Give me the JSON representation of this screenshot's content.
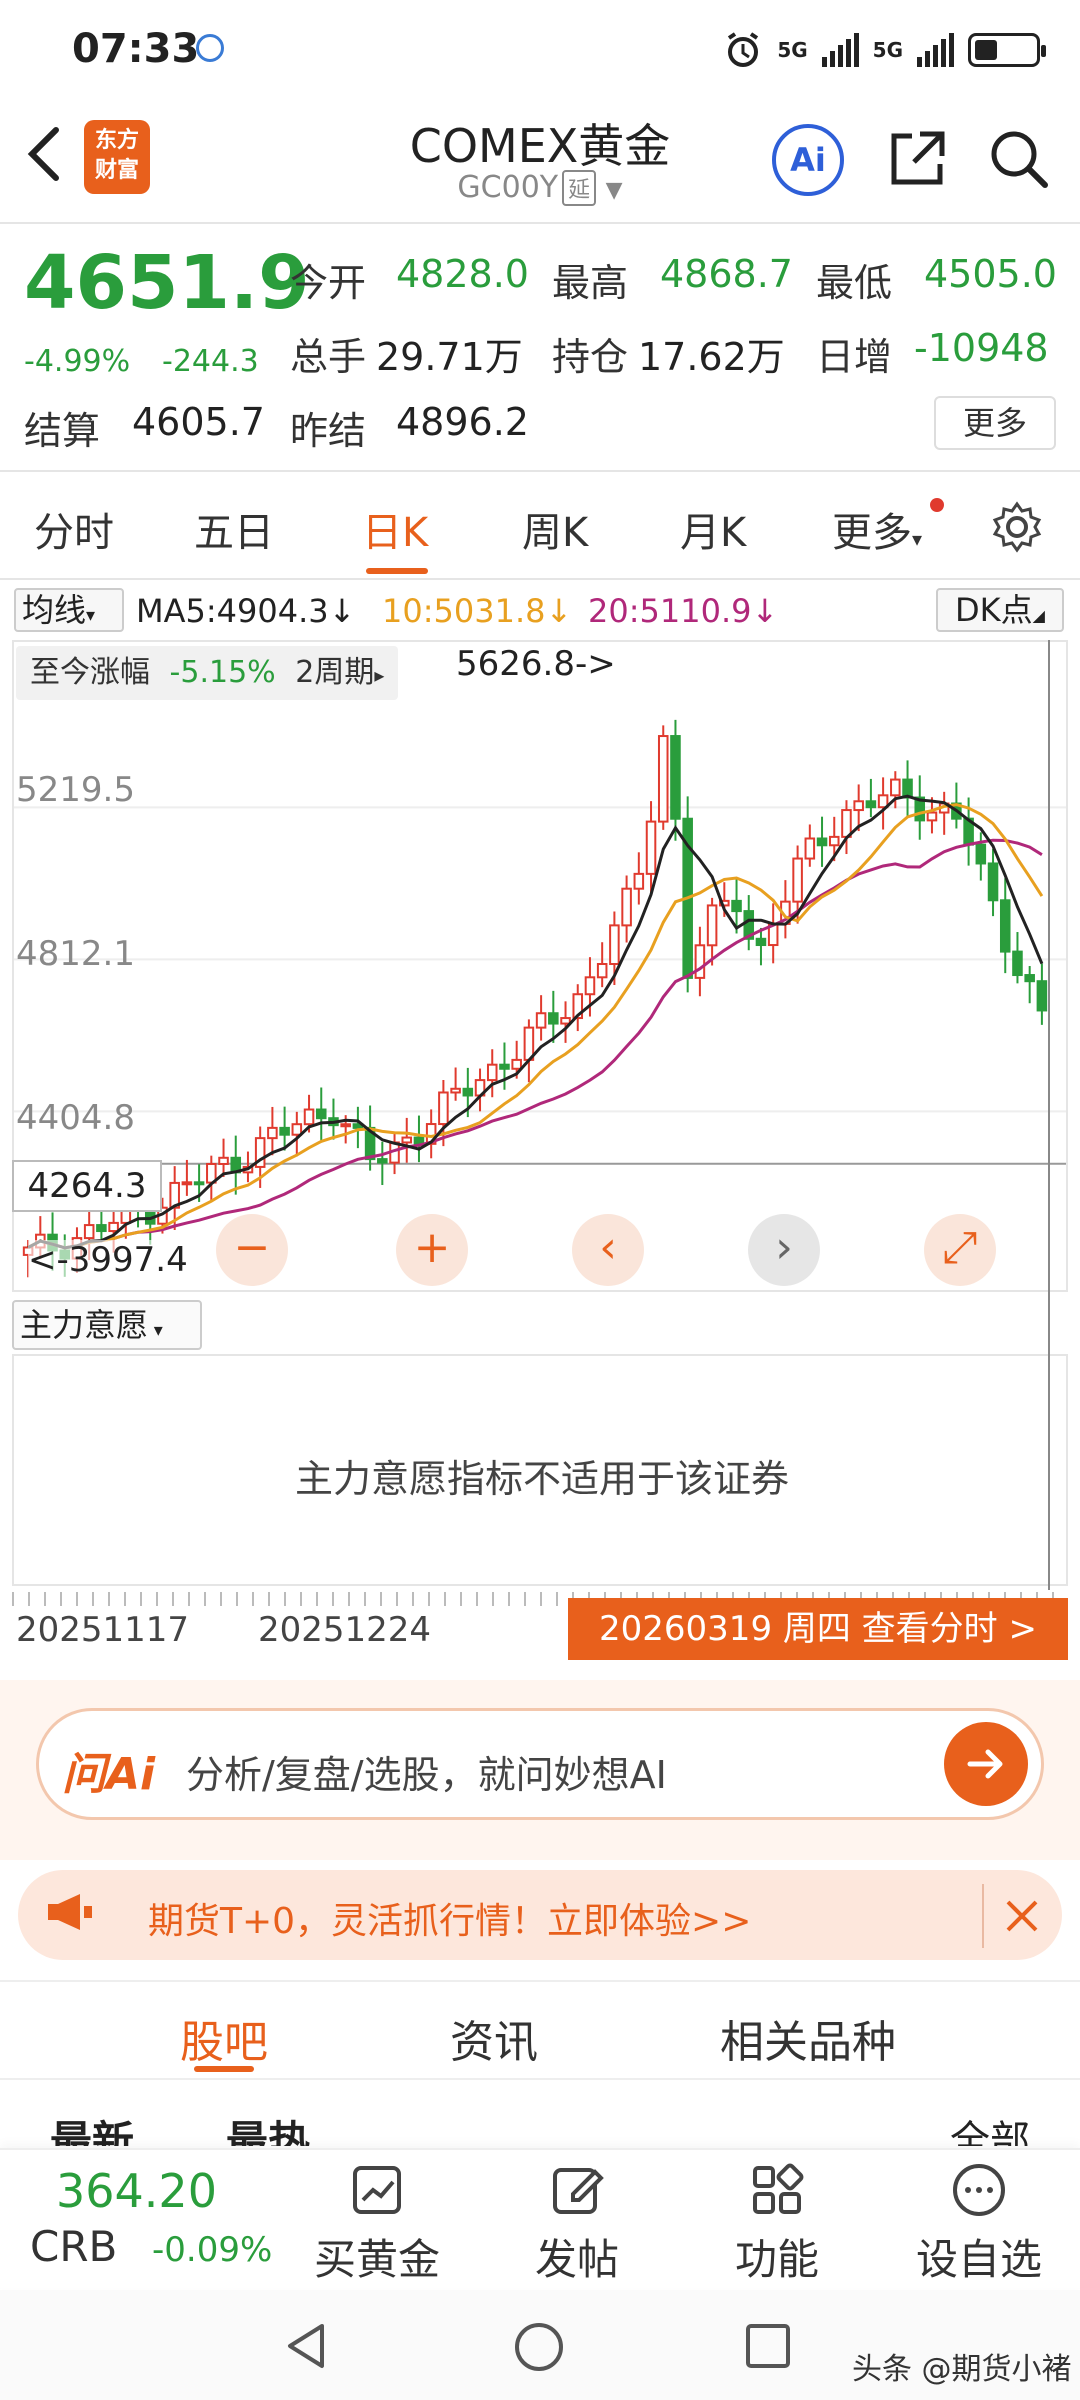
{
  "status": {
    "time": "07:33",
    "net1": "5G",
    "net2": "5G"
  },
  "header": {
    "title": "COMEX黄金",
    "code": "GC00Y",
    "tag": "延",
    "logo_line1": "东方",
    "logo_line2": "财富",
    "ai_label": "Ai"
  },
  "quote": {
    "price": "4651.9",
    "pct": "-4.99%",
    "change": "-244.3",
    "open_label": "今开",
    "open": "4828.0",
    "high_label": "最高",
    "high": "4868.7",
    "low_label": "最低",
    "low": "4505.0",
    "vol_label": "总手",
    "vol": "29.71万",
    "oi_label": "持仓",
    "oi": "17.62万",
    "daily_label": "日增",
    "daily": "-10948",
    "settle_label": "结算",
    "settle": "4605.7",
    "prev_label": "昨结",
    "prev": "4896.2",
    "more": "更多"
  },
  "period_tabs": [
    "分时",
    "五日",
    "日K",
    "周K",
    "月K",
    "更多"
  ],
  "ma": {
    "selector": "均线",
    "ma5": "MA5:4904.3↓",
    "ma10": "10:5031.8↓",
    "ma20": "20:5110.9↓",
    "dk": "DK点"
  },
  "chart": {
    "since_label": "至今涨幅",
    "since_value": "-5.15%",
    "since_period": "2周期",
    "max_label": "5626.8->",
    "y_labels": [
      "5219.5",
      "4812.1",
      "4404.8"
    ],
    "cur_price": "4264.3",
    "min_label": "<-3997.4",
    "controls": [
      "−",
      "+",
      "‹",
      "›",
      "⤢"
    ],
    "colors": {
      "up": "#e03a2e",
      "down": "#2a9d3c",
      "ma5": "#222222",
      "ma10": "#e8a020",
      "ma20": "#b0287a"
    }
  },
  "chart_data": {
    "type": "candlestick",
    "series_ma": [
      "MA5",
      "MA10",
      "MA20"
    ],
    "ylim": [
      3997.4,
      5626.8
    ],
    "y_ticks": [
      4404.8,
      4812.1,
      5219.5
    ],
    "x_labels": [
      "20251117",
      "20251224"
    ],
    "max": 5626.8,
    "min": 3997.4,
    "last": 4651.9
  },
  "indicator": {
    "selector": "主力意愿",
    "message": "主力意愿指标不适用于该证券"
  },
  "dates": {
    "d1": "20251117",
    "d2": "20251224",
    "intraday": "20260319 周四 查看分时 >"
  },
  "ai": {
    "logo": "问Ai",
    "placeholder": "分析/复盘/选股，就问妙想AI"
  },
  "promo": {
    "text": "期货T+0，灵活抓行情！立即体验>>"
  },
  "content_tabs": [
    "股吧",
    "资讯",
    "相关品种"
  ],
  "sort": {
    "latest": "最新",
    "hot": "最热",
    "all": "全部"
  },
  "bottom": {
    "crb_price": "364.20",
    "crb_name": "CRB",
    "crb_change": "-0.09%",
    "buy_gold": "买黄金",
    "post": "发帖",
    "func": "功能",
    "watch": "设自选"
  },
  "watermark": "头条 @期货小褚"
}
